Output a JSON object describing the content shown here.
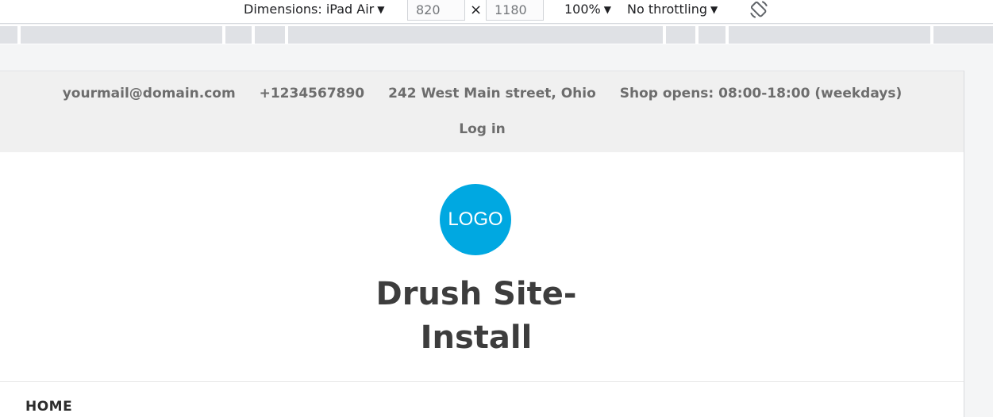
{
  "devtools": {
    "dimensions_label": "Dimensions: iPad Air",
    "width_value": "820",
    "times_symbol": "×",
    "height_value": "1180",
    "zoom": "100%",
    "throttling": "No throttling",
    "dropdown_arrow": "▼"
  },
  "page": {
    "topbar": {
      "email": "yourmail@domain.com",
      "phone": "+1234567890",
      "address": "242 West Main street, Ohio",
      "hours": "Shop opens: 08:00-18:00 (weekdays)",
      "login": "Log in"
    },
    "branding": {
      "logo_text": "LOGO",
      "site_name": "Drush Site-Install",
      "logo_color": "#00a8e1"
    },
    "nav": {
      "home": "HOME"
    }
  }
}
